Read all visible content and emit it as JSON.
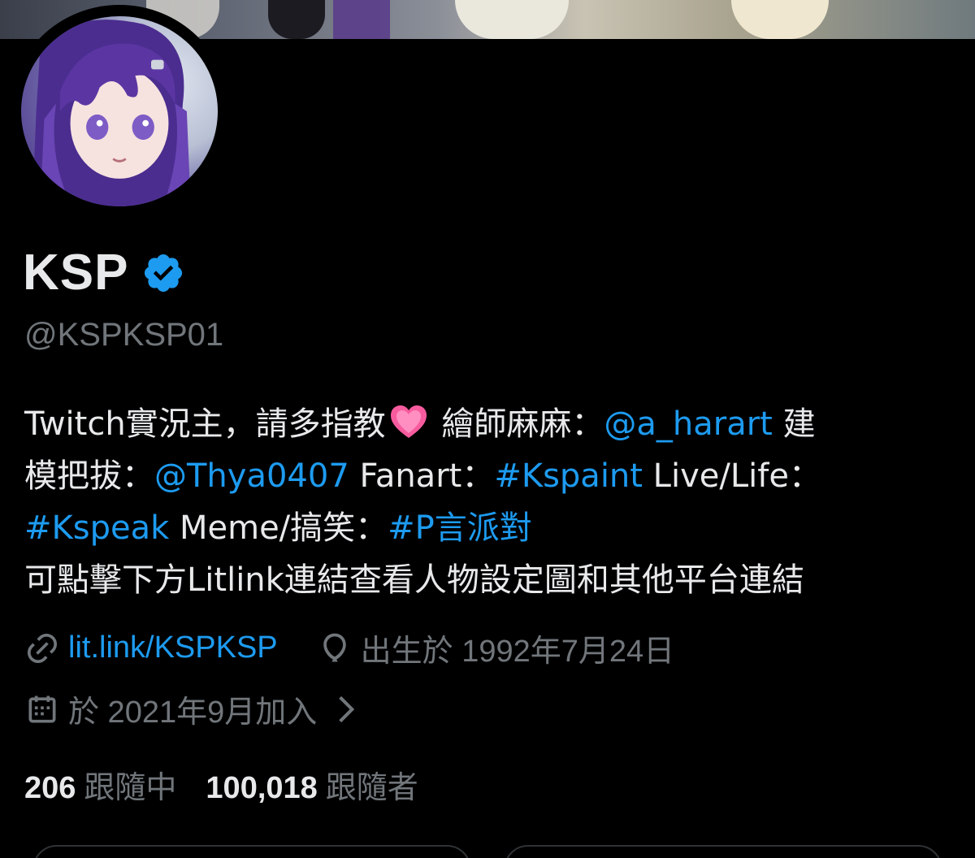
{
  "profile": {
    "display_name": "KSP",
    "handle": "@KSPKSP01",
    "verified": true
  },
  "bio": {
    "line1_a": "Twitch實況主，請多指教",
    "line1_b": " 繪師麻麻：",
    "mention_artist": "@a_harart",
    "line1_c": " 建",
    "line2_a": "模把拔：",
    "mention_modeler": "@Thya0407",
    "line2_b": " Fanart：",
    "tag_fanart": "#Kspaint",
    "line2_c": " Live/Life：",
    "tag_live": "#Kspeak",
    "line3_a": " Meme/搞笑：",
    "tag_meme": "#P言派對",
    "line4": "可點擊下方Litlink連結查看人物設定圖和其他平台連結"
  },
  "meta": {
    "website": "lit.link/KSPKSP",
    "birthday": "出生於 1992年7月24日",
    "joined": "於 2021年9月加入"
  },
  "stats": {
    "following_count": "206",
    "following_label": "跟隨中",
    "followers_count": "100,018",
    "followers_label": "跟隨者"
  },
  "colors": {
    "background": "#000000",
    "text_primary": "#e7e9ea",
    "text_secondary": "#71767b",
    "accent": "#1d9bf0",
    "verified_badge": "#1d9bf0"
  },
  "icons": {
    "verified": "verified-badge-icon",
    "heart": "growing-heart-icon",
    "website": "link-icon",
    "birthday": "balloon-icon",
    "joined": "calendar-icon",
    "chevron": "chevron-right-icon"
  }
}
